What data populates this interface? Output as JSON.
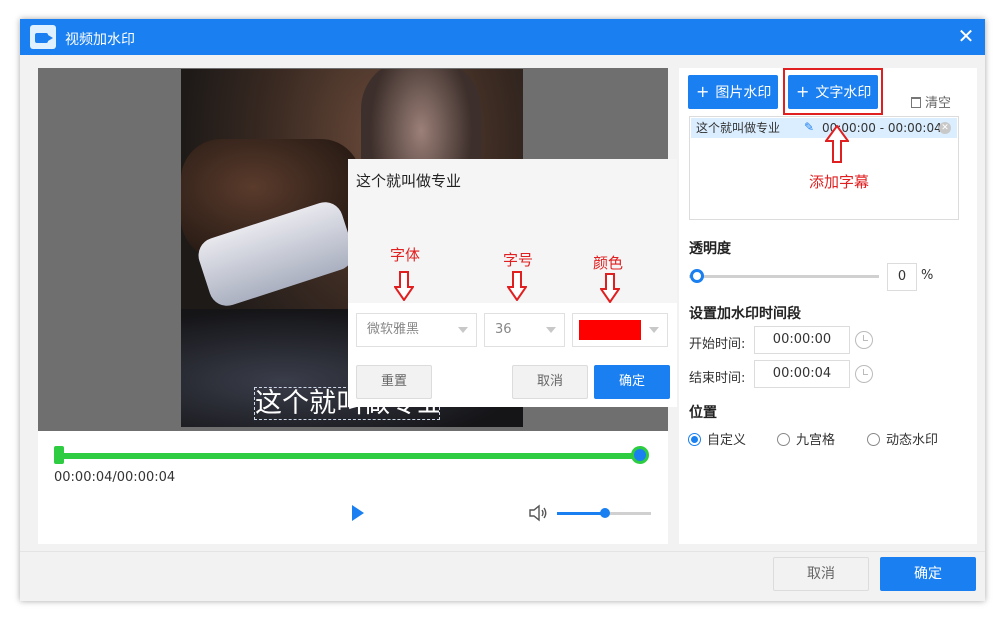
{
  "window": {
    "title": "视频加水印"
  },
  "preview": {
    "subtitle_text": "这个就叫做专业",
    "time_display": "00:00:04/00:00:04",
    "progress_fraction": 1.0,
    "volume_fraction": 0.5
  },
  "text_dialog": {
    "text": "这个就叫做专业",
    "font": "微软雅黑",
    "size": "36",
    "color": "#ff0000",
    "reset_label": "重置",
    "cancel_label": "取消",
    "ok_label": "确定",
    "annotations": {
      "font": "字体",
      "size": "字号",
      "color": "颜色"
    }
  },
  "sidebar": {
    "image_watermark_label": "图片水印",
    "text_watermark_label": "文字水印",
    "clear_label": "清空",
    "add_subtitle_annotation": "添加字幕",
    "items": [
      {
        "name": "这个就叫做专业",
        "range": "00:00:00  - 00:00:04"
      }
    ],
    "opacity_title": "透明度",
    "opacity_value": "0",
    "opacity_unit": "%",
    "time_section_title": "设置加水印时间段",
    "start_label": "开始时间:",
    "start_value": "00:00:00",
    "end_label": "结束时间:",
    "end_value": "00:00:04",
    "position_title": "位置",
    "position_options": [
      "自定义",
      "九宫格",
      "动态水印"
    ],
    "position_selected": "自定义"
  },
  "footer": {
    "cancel_label": "取消",
    "ok_label": "确定"
  },
  "colors": {
    "accent": "#1a7ff0",
    "annotation": "#e02020",
    "progress": "#2ecc40"
  }
}
